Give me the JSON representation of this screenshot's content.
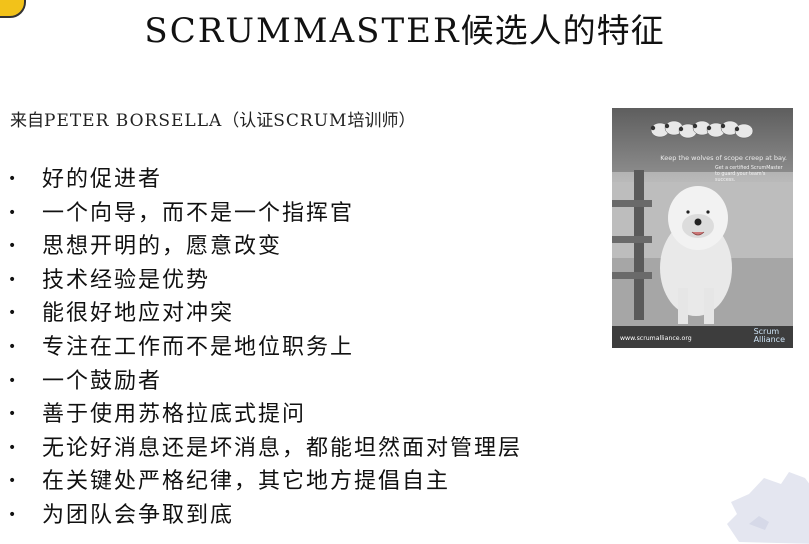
{
  "slide": {
    "title_latin": "SCRUMMASTER",
    "title_cn": "候选人的特征",
    "source_prefix": "来自",
    "source_name": "PETER BORSELLA",
    "source_paren_open": "（认证",
    "source_scrum": "SCRUM",
    "source_paren_close": "培训师）",
    "bullet_symbol": "•",
    "bullets": [
      "好的促进者",
      "一个向导，而不是一个指挥官",
      "思想开明的，愿意改变",
      "技术经验是优势",
      "能很好地应对冲突",
      "专注在工作而不是地位职务上",
      "一个鼓励者",
      "善于使用苏格拉底式提问",
      "无论好消息还是坏消息，都能坦然面对管理层",
      "在关键处严格纪律，其它地方提倡自主",
      "为团队会争取到底"
    ]
  },
  "poster": {
    "tagline": "Keep the wolves of scope creep at bay.",
    "subline": "Get a certified ScrumMaster to guard your team's success.",
    "url": "www.scrumalliance.org",
    "brand_line1": "Scrum",
    "brand_line2": "Alliance"
  },
  "colors": {
    "accent_tl": "#f2c21a",
    "text": "#111111"
  }
}
